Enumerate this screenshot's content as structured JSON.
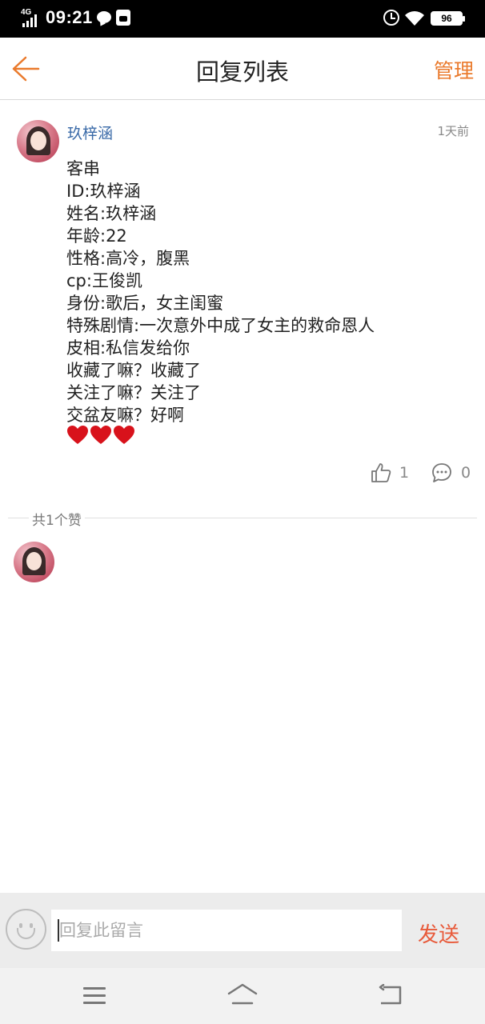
{
  "status_bar": {
    "network": "4G",
    "time": "09:21",
    "battery": "96"
  },
  "header": {
    "title": "回复列表",
    "manage_label": "管理"
  },
  "comment": {
    "user_name": "玖梓涵",
    "time": "1天前",
    "lines": [
      "客串",
      "ID:玖梓涵",
      "姓名:玖梓涵",
      "年龄:22",
      "性格:高冷，腹黑",
      "cp:王俊凯",
      "身份:歌后，女主闺蜜",
      "特殊剧情:一次意外中成了女主的救命恩人",
      "皮相:私信发给你",
      "收藏了嘛？收藏了",
      "关注了嘛？关注了",
      "交盆友嘛？好啊"
    ],
    "hearts": "❤️❤️❤️",
    "like_count": "1",
    "reply_count": "0"
  },
  "likes_section": {
    "total_label": "共1个赞"
  },
  "reply_bar": {
    "placeholder": "回复此留言",
    "send_label": "发送"
  },
  "colors": {
    "accent_orange": "#ea7a2c",
    "send_red": "#e85a3a",
    "username_blue": "#3a6aa8"
  }
}
